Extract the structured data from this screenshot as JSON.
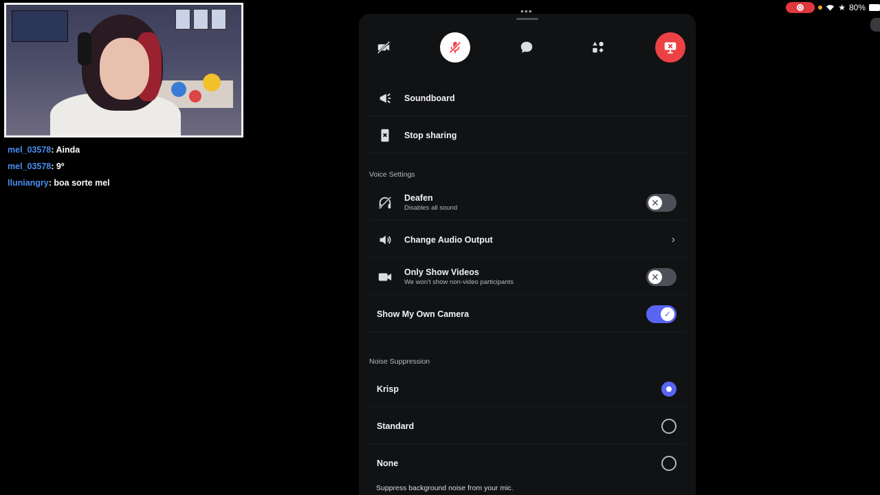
{
  "colors": {
    "accent": "#5865f2",
    "danger": "#ed4245",
    "chat_username": "#4a8ef0",
    "sheet_bg": "#111214"
  },
  "stream_chat": [
    {
      "user": "mel_03578",
      "message": "Ainda"
    },
    {
      "user": "mel_03578",
      "message": "9º"
    },
    {
      "user": "lluniangry",
      "message": "boa sorte mel"
    }
  ],
  "status_bar": {
    "battery": "80%",
    "dots": "•••"
  },
  "call_controls": [
    {
      "name": "camera-off-icon",
      "state": "off"
    },
    {
      "name": "mic-muted-icon",
      "state": "active"
    },
    {
      "name": "chat-bubble-icon",
      "state": "normal"
    },
    {
      "name": "activities-icon",
      "state": "normal"
    },
    {
      "name": "stop-screen-share-icon",
      "state": "danger"
    }
  ],
  "menu": {
    "soundboard": "Soundboard",
    "stop_sharing": "Stop sharing"
  },
  "voice_settings": {
    "title": "Voice Settings",
    "deafen": {
      "label": "Deafen",
      "sub": "Disables all sound",
      "enabled": false
    },
    "audio_output": {
      "label": "Change Audio Output"
    },
    "only_videos": {
      "label": "Only Show Videos",
      "sub": "We won't show non-video participants",
      "enabled": false
    },
    "own_camera": {
      "label": "Show My Own Camera",
      "enabled": true
    }
  },
  "noise_suppression": {
    "title": "Noise Suppression",
    "options": [
      "Krisp",
      "Standard",
      "None"
    ],
    "selected": "Krisp",
    "footnote": "Suppress background noise from your mic."
  }
}
